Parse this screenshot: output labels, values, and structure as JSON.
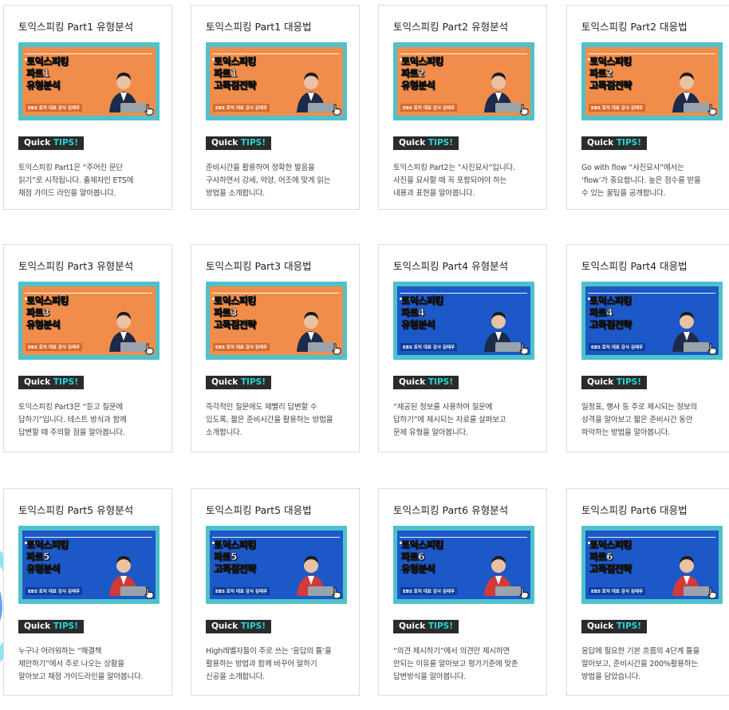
{
  "tips_label": "Quick",
  "tips_highlight": "TIPS!",
  "colors": {
    "orange": "#f08d4a",
    "blue": "#1c58c8",
    "teal_frame": "#4fc1cb",
    "teal_accent": "#27d4d8",
    "badge_bg": "#2b2b2b"
  },
  "cards": [
    {
      "title": "토익스피킹 Part1 유형분석",
      "thumb_lines": [
        "토익스피킹",
        "파트1",
        "유형분석"
      ],
      "thumb_sub": "EBS 토익 대표 강사 김태우",
      "theme": "orange",
      "desc": [
        "토익스피킹 Part1은 “주어진 문단",
        "읽기”로 시작됩니다. 출제자인 ETS에",
        "채점 가이드 라인을 알아봅니다."
      ]
    },
    {
      "title": "토익스피킹 Part1 대응법",
      "thumb_lines": [
        "토익스피킹",
        "파트1",
        "고득점전략"
      ],
      "thumb_sub": "EBS 토익 대표 강사 김태우",
      "theme": "orange",
      "desc": [
        "준비시간을 활용하여 정확한 발음을",
        "구사하면서 강세, 억양, 어조에 맞게 읽는",
        "방법을 소개합니다."
      ]
    },
    {
      "title": "토익스피킹 Part2 유형분석",
      "thumb_lines": [
        "토익스피킹",
        "파트2",
        "유형분석"
      ],
      "thumb_sub": "EBS 토익 대표 강사 김태우",
      "theme": "orange",
      "desc": [
        "토익스피킹 Part2는 “사진묘사”입니다.",
        "사진을 묘사할 때 꼭 포함되어야 하는",
        "내용과 표현을 알아봅니다."
      ]
    },
    {
      "title": "토익스피킹 Part2 대응법",
      "thumb_lines": [
        "토익스피킹",
        "파트2",
        "고득점전략"
      ],
      "thumb_sub": "EBS 토익 대표 강사 김태우",
      "theme": "orange",
      "desc": [
        "Go with flow “사진묘사”에서는",
        "‘flow’가 중요합니다. 높은 점수를 받을",
        "수 있는 꿀팁을 공개합니다."
      ]
    },
    {
      "title": "토익스피킹 Part3 유형분석",
      "thumb_lines": [
        "토익스피킹",
        "파트3",
        "유형분석"
      ],
      "thumb_sub": "EBS 토익 대표 강사 김태우",
      "theme": "orange",
      "desc": [
        "토익스피킹 Part3은 “듣고 질문에",
        "답하기”입니다. 테스트 방식과 함께",
        "답변할 때 주의할 점을 알아봅니다."
      ]
    },
    {
      "title": "토익스피킹 Part3 대응법",
      "thumb_lines": [
        "토익스피킹",
        "파트3",
        "고득점전략"
      ],
      "thumb_sub": "EBS 토익 대표 강사 김태우",
      "theme": "orange",
      "desc": [
        "즉각적인 질문에도 재빨리 답변할 수",
        "있도록, 짧은 준비시간을 활용하는 방법을",
        "소개합니다."
      ]
    },
    {
      "title": "토익스피킹 Part4 유형분석",
      "thumb_lines": [
        "토익스피킹",
        "파트4",
        "유형분석"
      ],
      "thumb_sub": "EBS 토익 대표 강사 김태우",
      "theme": "blue",
      "desc": [
        "“제공된 정보를 사용하여 질문에",
        "답하기”에 제시되는 자료를 살펴보고",
        "문제 유형을 알아봅니다."
      ]
    },
    {
      "title": "토익스피킹 Part4 대응법",
      "thumb_lines": [
        "토익스피킹",
        "파트4",
        "고득점전략"
      ],
      "thumb_sub": "EBS 토익 대표 강사 김태우",
      "theme": "blue",
      "desc": [
        "일정표, 행사 등 주로 제시되는 정보의",
        "성격을 알아보고 짧은 준비시간 동안",
        "파악하는 방법을 알아봅니다."
      ]
    },
    {
      "title": "토익스피킹 Part5 유형분석",
      "thumb_lines": [
        "토익스피킹",
        "파트5",
        "유형분석"
      ],
      "thumb_sub": "EBS 토익 대표 강사 김태우",
      "theme": "blue",
      "desc": [
        "누구나 어려워하는 “해결책",
        "제안하기”에서 주로 나오는 상황을",
        "알아보고 채점 가이드라인을 알아봅니다."
      ]
    },
    {
      "title": "토익스피킹 Part5 대응법",
      "thumb_lines": [
        "토익스피킹",
        "파트5",
        "고득점전략"
      ],
      "thumb_sub": "EBS 토익 대표 강사 김태우",
      "theme": "blue",
      "desc": [
        "High레벨자들이 주로 쓰는 ‘응답의 틀’을",
        "활용하는 방법과 함께 바꾸어 말하기",
        "신공을 소개합니다."
      ]
    },
    {
      "title": "토익스피킹 Part6 유형분석",
      "thumb_lines": [
        "토익스피킹",
        "파트6",
        "유형분석"
      ],
      "thumb_sub": "EBS 토익 대표 강사 김태우",
      "theme": "blue",
      "desc": [
        "“의견 제시하기”에서 의견만 제시하면",
        "안되는 이유를 알아보고 평가기준에 맞춘",
        "답변방식을 알아봅니다."
      ]
    },
    {
      "title": "토익스피킹 Part6 대응법",
      "thumb_lines": [
        "토익스피킹",
        "파트6",
        "고득점전략"
      ],
      "thumb_sub": "EBS 토익 대표 강사 김태우",
      "theme": "blue",
      "desc": [
        "응답에 필요한 기본 흐름의 4단계 틀을",
        "알아보고, 준비시간을 200%활용하는",
        "방법을 담았습니다."
      ]
    }
  ]
}
